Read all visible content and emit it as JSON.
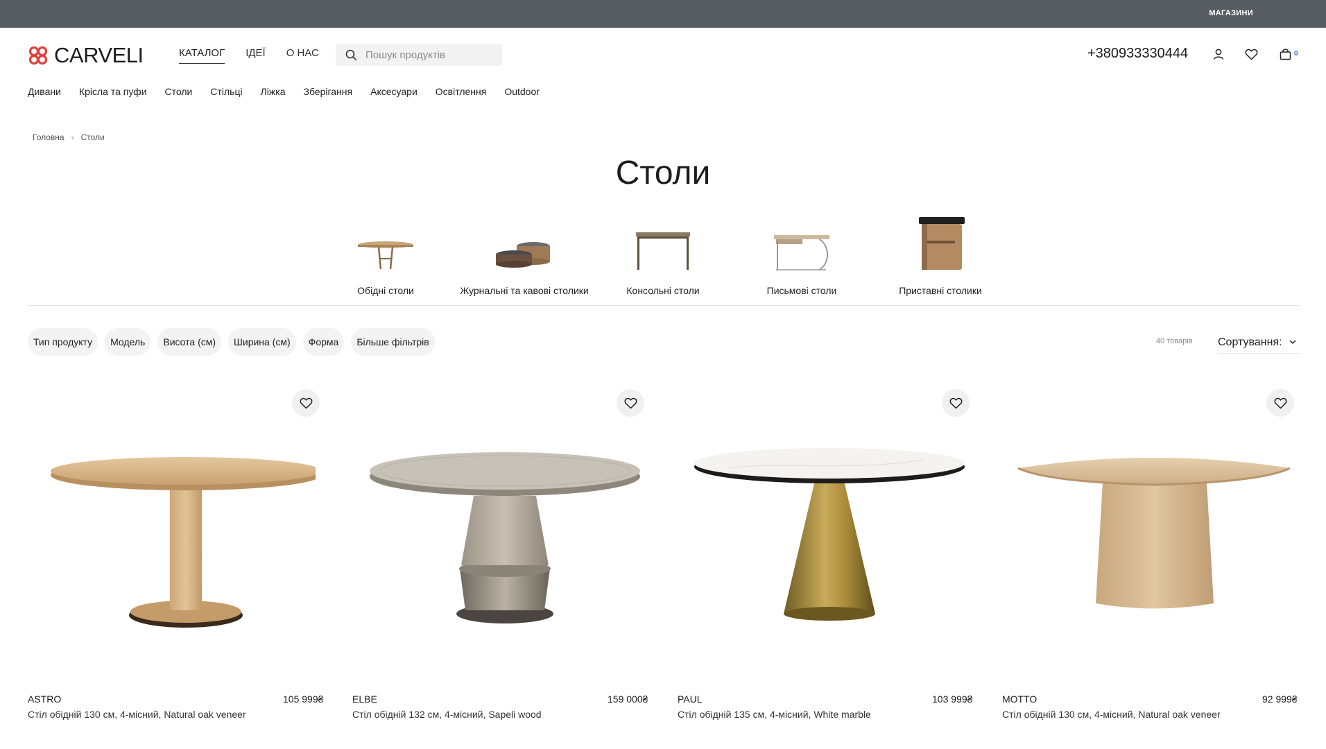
{
  "topbar": {
    "stores_label": "МАГАЗИНИ"
  },
  "brand": {
    "name": "CARVELI",
    "accent": "#e0423a"
  },
  "main_nav": [
    {
      "label": "КАТАЛОГ",
      "active": true
    },
    {
      "label": "ІДЕЇ",
      "active": false
    },
    {
      "label": "О НАС",
      "active": false
    }
  ],
  "search": {
    "placeholder": "Пошук продуктів"
  },
  "contact": {
    "phone": "+380933330444"
  },
  "cart": {
    "count": "0"
  },
  "category_nav": [
    "Дивани",
    "Крісла та пуфи",
    "Столи",
    "Стільці",
    "Ліжка",
    "Зберігання",
    "Аксесуари",
    "Освітлення",
    "Outdoor"
  ],
  "breadcrumb": [
    "Головна",
    "Столи"
  ],
  "page_title": "Столи",
  "subcategories": [
    {
      "label": "Обідні столи",
      "icon": "dining-table-thumb"
    },
    {
      "label": "Журнальні та кавові столики",
      "icon": "coffee-table-thumb"
    },
    {
      "label": "Консольні столи",
      "icon": "console-table-thumb"
    },
    {
      "label": "Письмові столи",
      "icon": "desk-thumb"
    },
    {
      "label": "Приставні столики",
      "icon": "side-table-thumb"
    }
  ],
  "filters": [
    "Тип продукту",
    "Модель",
    "Висота (см)",
    "Ширина (см)",
    "Форма",
    "Більше фільтрів"
  ],
  "results": {
    "count_label": "40 товарів",
    "sort_label": "Сортування:"
  },
  "products": [
    {
      "name": "ASTRO",
      "price": "105 999₴",
      "description": "Стіл обідній 130 см, 4-місний, Natural oak veneer"
    },
    {
      "name": "ELBE",
      "price": "159 000₴",
      "description": "Стіл обідній 132 см, 4-місний, Sapeli wood"
    },
    {
      "name": "PAUL",
      "price": "103 999₴",
      "description": "Стіл обідній 135 см, 4-місний, White marble"
    },
    {
      "name": "MOTTO",
      "price": "92 999₴",
      "description": "Стіл обідній 130 см, 4-місний, Natural oak veneer"
    }
  ]
}
